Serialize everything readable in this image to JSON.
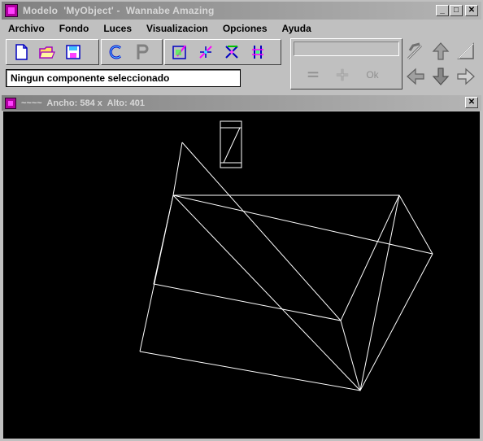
{
  "window": {
    "title": "Modelo  'MyObject' -  Wannabe Amazing",
    "controls": {
      "minimize": "_",
      "maximize": "□",
      "close": "✕"
    }
  },
  "menu": [
    "Archivo",
    "Fondo",
    "Luces",
    "Visualizacion",
    "Opciones",
    "Ayuda"
  ],
  "toolbar": {
    "group1": [
      "new-file-icon",
      "open-folder-icon",
      "save-icon"
    ],
    "group2": [
      "copy-icon",
      "paste-icon"
    ],
    "group3": [
      "select-tool-icon",
      "move-tool-icon",
      "rotate-tool-icon",
      "scale-tool-icon"
    ]
  },
  "status": {
    "text": "Ningun componente seleccionado"
  },
  "right_panel": {
    "input_value": "",
    "buttons": {
      "minus": "=",
      "plus": "+",
      "ok": "Ok"
    }
  },
  "navigation": [
    "arrow-upleft-icon",
    "arrow-up-icon",
    "arrow-upright-icon",
    "arrow-left-icon",
    "arrow-down-icon",
    "arrow-right-icon"
  ],
  "child_window": {
    "title": "~~~~  Ancho: 584 x  Alto: 401",
    "close": "✕"
  },
  "colors": {
    "title_bar": "#808080",
    "canvas_bg": "#000000",
    "wireframe": "#ffffff",
    "app_icon": "#b000a0"
  }
}
